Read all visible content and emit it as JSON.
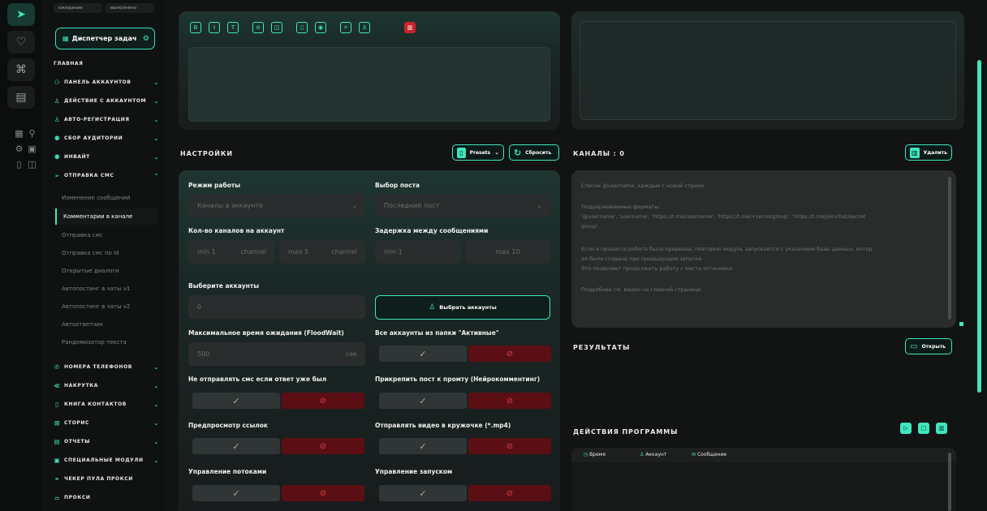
{
  "sidebar": {
    "status_tabs": [
      "ожидание",
      "выполнено"
    ],
    "dispatcher_label": "Диспетчер задач",
    "main_label": "ГЛАВНАЯ",
    "sections_top": [
      {
        "label": "ПАНЕЛЬ АККАУНТОВ"
      },
      {
        "label": "ДЕЙСТВИЕ С АККАУНТОМ"
      },
      {
        "label": "АВТО-РЕГИСТРАЦИЯ"
      },
      {
        "label": "СБОР АУДИТОРИИ"
      },
      {
        "label": "ИНВАЙТ"
      },
      {
        "label": "ОТПРАВКА СМС"
      }
    ],
    "sms_items": [
      "Изменение сообщений",
      "Комментарии в канале",
      "Отправка смс",
      "Отправка смс по id",
      "Открытые диалоги",
      "Автопостинг в чаты v1",
      "Автопостинг в чаты v2",
      "Автоответчик",
      "Рандомизатор текста"
    ],
    "active_item": "Комментарии в канале",
    "sections_bottom": [
      {
        "label": "НОМЕРА ТЕЛЕФОНОВ"
      },
      {
        "label": "НАКРУТКА"
      },
      {
        "label": "КНИГА КОНТАКТОВ"
      },
      {
        "label": "СТОРИС"
      },
      {
        "label": "ОТЧЕТЫ"
      },
      {
        "label": "СПЕЦИАЛЬНЫЕ МОДУЛИ"
      },
      {
        "label": "ЧЕКЕР ПУЛА ПРОКСИ"
      },
      {
        "label": "ПРОКСИ"
      }
    ]
  },
  "settings": {
    "header": "НАСТРОЙКИ",
    "presets_label": "Presets",
    "reset_label": "Сбросить",
    "mode_label": "Режим работы",
    "mode_value": "Каналы в аккаунте",
    "post_label": "Выбор поста",
    "post_value": "Последний пост",
    "channels_label": "Кол-во каналов на аккаунт",
    "ch_min": "min 1",
    "ch_min_unit": "channel",
    "ch_max": "max 5",
    "ch_max_unit": "channel",
    "delay_label": "Задержка между сообщениями",
    "delay_min": "min 1",
    "delay_max": "max 10",
    "accounts_label": "Выберите аккаунты",
    "accounts_value": "0",
    "select_accounts_label": "Выбрать аккаунты",
    "floodwait_label": "Максимальное время ожидания (FloodWait)",
    "floodwait_value": "500",
    "floodwait_unit": "сек",
    "active_folder_label": "Все аккаунты из папки \"Активные\"",
    "no_reply_label": "Не отправлять смс если ответ уже был",
    "attach_label": "Прикрепить пост к промту (Нейрокомментинг)",
    "preview_label": "Предпросмотр ссылок",
    "video_label": "Отправлять видео в кружочке (*.mp4)",
    "threads_label": "Управление потоками",
    "launch_label": "Управление запуском",
    "yes_glyph": "✓",
    "no_glyph": "⊘"
  },
  "channels": {
    "header": "КАНАЛЫ : 0",
    "delete_label": "Удалить",
    "info_line1": "Список @username, каждый с новой строки.",
    "info_line2": "Поддерживаемые форматы:",
    "info_line3": "'@username', 'username', 'https://t.me/username', 'https://t.me/+secretgroup', 'https://t.me/joinchat/secret",
    "info_line4": "group'.",
    "info_line5": "Если в процессе работа была прервана, повторно модуль запускается с указанием базы данных, котор",
    "info_line6": "ая была создана при предыдущем запуске.",
    "info_line7": "Это позволяет продолжить работу с места остановки.",
    "info_line8": "Подробнее см. видео на главной странице."
  },
  "results": {
    "header": "РЕЗУЛЬТАТЫ",
    "open_label": "Открыть"
  },
  "actions": {
    "header": "ДЕЙСТВИЯ ПРОГРАММЫ",
    "col_time": "Время",
    "col_account": "Аккаунт",
    "col_message": "Сообщение"
  },
  "colors": {
    "accent": "#3ee7be",
    "danger": "#c8232c"
  }
}
